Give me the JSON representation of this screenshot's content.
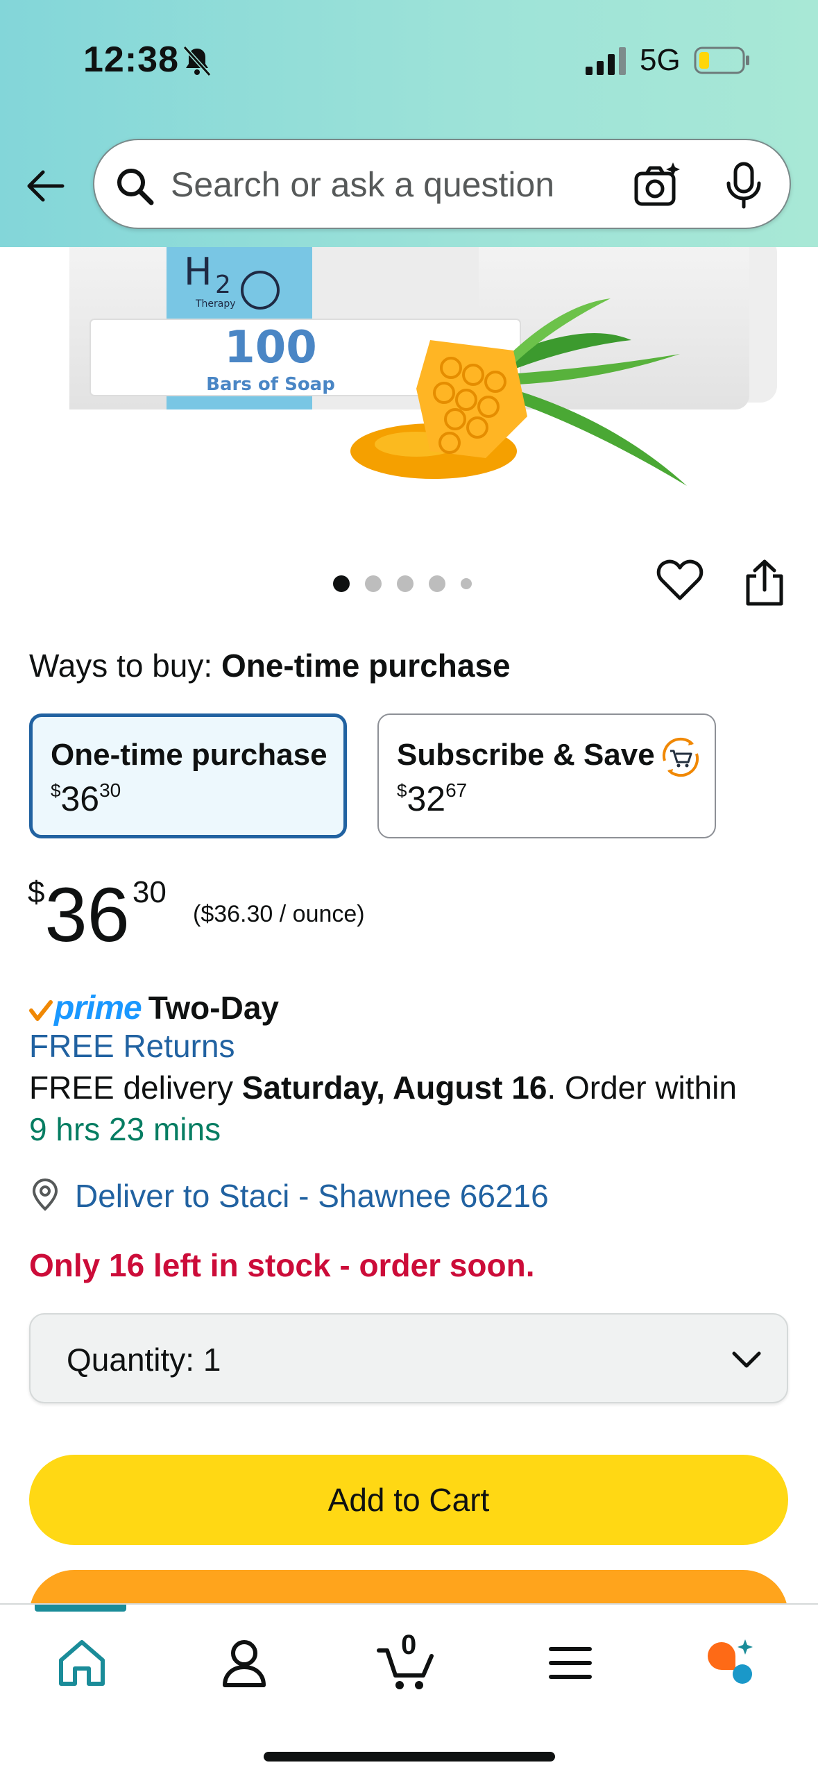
{
  "status_bar": {
    "time": "12:38",
    "network": "5G",
    "icons": [
      "bell-slash-icon",
      "signal-icon",
      "battery-icon"
    ]
  },
  "search": {
    "placeholder": "Search or ask a question",
    "icons": [
      "back-arrow-icon",
      "search-icon",
      "camera-icon",
      "mic-icon"
    ]
  },
  "product_image": {
    "brand_logo": "H2O",
    "brand_sub": "Therapy",
    "count": "100",
    "caption": "Bars of Soap"
  },
  "carousel": {
    "dot_count": 5,
    "active_index": 0
  },
  "ways_to_buy": {
    "label": "Ways to buy:",
    "selected": "One-time purchase",
    "options": [
      {
        "title": "One-time purchase",
        "currency": "$",
        "dollars": "36",
        "cents": "30"
      },
      {
        "title": "Subscribe & Save",
        "currency": "$",
        "dollars": "32",
        "cents": "67"
      }
    ]
  },
  "price": {
    "currency": "$",
    "dollars": "36",
    "cents": "30",
    "unit_price": "($36.30 / ounce)"
  },
  "delivery": {
    "prime_label": "prime",
    "prime_speed": "Two-Day",
    "free_returns": "FREE Returns",
    "delivery_prefix": "FREE delivery ",
    "delivery_date": "Saturday, August 16",
    "delivery_suffix": ". Order within",
    "countdown": "9 hrs 23 mins",
    "deliver_to": "Deliver to Staci - Shawnee 66216"
  },
  "stock": {
    "warning": "Only 16 left in stock - order soon."
  },
  "quantity": {
    "label": "Quantity:",
    "value": "1"
  },
  "buttons": {
    "add_to_cart": "Add to Cart"
  },
  "bottom_nav": {
    "cart_count": "0",
    "items": [
      "home-icon",
      "account-icon",
      "cart-icon",
      "menu-icon",
      "rufus-icon"
    ]
  },
  "colors": {
    "header_bg": "#9ee3d8",
    "link": "#2162a1",
    "prime_blue": "#1a98ff",
    "stock_red": "#cc0c39",
    "countdown_green": "#067d62",
    "add_to_cart": "#ffd814",
    "buy_now": "#ffa41c",
    "selected_border": "#2162a1"
  }
}
